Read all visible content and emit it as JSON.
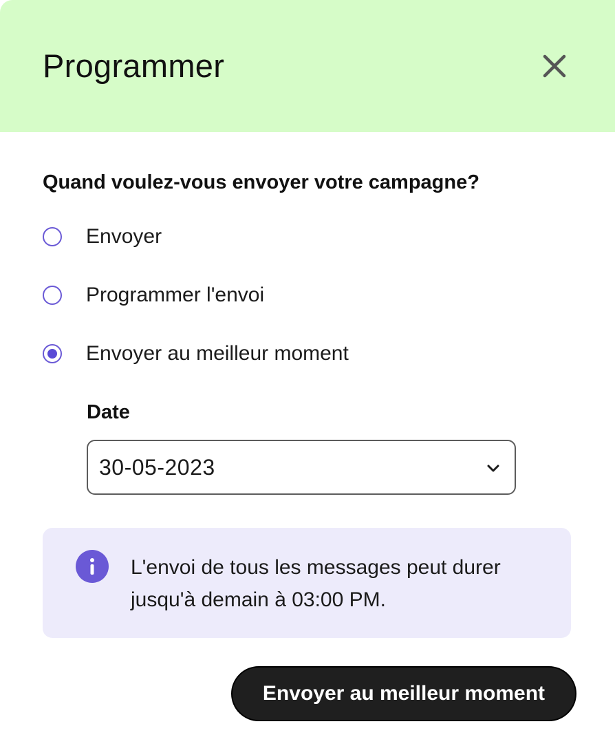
{
  "modal": {
    "title": "Programmer",
    "close_icon": "close-icon"
  },
  "form": {
    "question": "Quand voulez-vous envoyer votre campagne?",
    "options": [
      {
        "label": "Envoyer",
        "checked": false
      },
      {
        "label": "Programmer l'envoi",
        "checked": false
      },
      {
        "label": "Envoyer au meilleur moment",
        "checked": true
      }
    ],
    "date_label": "Date",
    "date_value": "30-05-2023",
    "date_icon": "chevron-down-icon"
  },
  "info": {
    "icon": "info-icon",
    "text_line1": "L'envoi de tous les messages peut durer",
    "text_line2": "jusqu'à demain à 03:00 PM."
  },
  "actions": {
    "primary_label": "Envoyer au meilleur moment"
  },
  "colors": {
    "header_bg": "#d6fcc8",
    "accent": "#6a59d6",
    "info_bg": "#edebfb",
    "button_bg": "#1f1f1f"
  }
}
